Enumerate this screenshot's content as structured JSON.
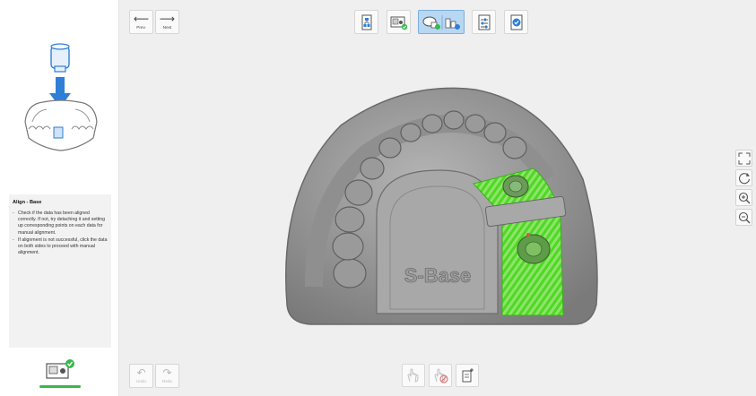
{
  "nav": {
    "prev_label": "Prev.",
    "next_label": "Next"
  },
  "history": {
    "undo_label": "Undo",
    "redo_label": "Redo"
  },
  "toolbar": {
    "tools": [
      {
        "icon": "tree-hierarchy-icon",
        "active": false
      },
      {
        "icon": "scan-data-check-icon",
        "active": false
      },
      {
        "icon": "align-data-icon",
        "active": true
      },
      {
        "icon": "sliders-icon",
        "active": false
      },
      {
        "icon": "shield-check-icon",
        "active": false
      }
    ]
  },
  "guide": {
    "title": "Align - Base",
    "items": [
      "Check if the data has been aligned correctly. If not, try detaching it and setting up corresponding points on each data for manual alignment.",
      "If alignment is not successful, click the data on both sides to proceed with manual alignment."
    ]
  },
  "model": {
    "base_text": "S-Base"
  },
  "colors": {
    "accent_green": "#36b94a",
    "highlight_green": "#52e02a",
    "active_tool": "#b8d7f2",
    "illustration_blue": "#2f7fd6"
  }
}
